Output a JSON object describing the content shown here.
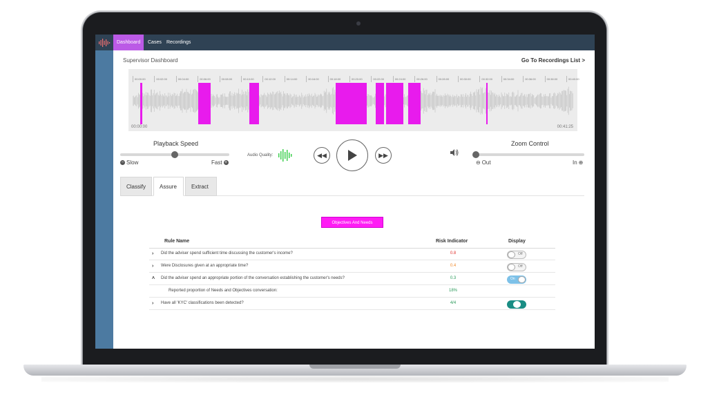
{
  "nav": {
    "tabs": [
      {
        "label": "Dashboard",
        "active": true
      },
      {
        "label": "Cases",
        "active": false
      },
      {
        "label": "Recordings",
        "active": false
      }
    ]
  },
  "header": {
    "title": "Supervisor Dashboard",
    "link": "Go To Recordings List >"
  },
  "waveform": {
    "tick_labels": [
      "00:00:00",
      "00:02:00",
      "00:04:00",
      "00:06:00",
      "00:08:00",
      "00:10:00",
      "00:12:00",
      "00:14:00",
      "00:16:00",
      "00:18:00",
      "00:20:00",
      "00:22:00",
      "00:24:00",
      "00:26:00",
      "00:28:00",
      "00:30:00",
      "00:32:00",
      "00:34:00",
      "00:36:00",
      "00:38:00",
      "00:40:00"
    ],
    "start_time": "00:00:00",
    "end_time": "00:41:25",
    "highlight_color": "#e81bed"
  },
  "controls": {
    "playback_label": "Playback Speed",
    "slow_label": "Slow",
    "fast_label": "Fast",
    "playback_level": 0.5,
    "audio_quality_label": "Audio Quality:",
    "zoom_label": "Zoom Control",
    "out_label": "Out",
    "in_label": "In",
    "zoom_level": 0.0
  },
  "tabs": [
    {
      "label": "Classify",
      "active": false
    },
    {
      "label": "Assure",
      "active": true
    },
    {
      "label": "Extract",
      "active": false
    }
  ],
  "objectives_button": "Objectives And Needs",
  "table": {
    "headers": {
      "rule": "Rule Name",
      "risk": "Risk Indicator",
      "display": "Display"
    },
    "rows": [
      {
        "chevron": "›",
        "rule": "Did the adviser spend sufficient time discussing the customer's income?",
        "risk": "0.8",
        "risk_color": "#e0302b",
        "toggle": "Off"
      },
      {
        "chevron": "›",
        "rule": "Were Disclosures given at an appropriate time?",
        "risk": "0.4",
        "risk_color": "#f08a2a",
        "toggle": "Off"
      },
      {
        "chevron": "˄",
        "rule": "Did the adviser spend an appropriate portion of the conversation establishing the customer's needs?",
        "risk": "0.3",
        "risk_color": "#2a9a5a",
        "toggle": "On"
      },
      {
        "chevron": "",
        "rule": "Reported proportion of Needs and Objectives conversation:",
        "risk": "18%",
        "risk_color": "#2a9a5a",
        "toggle": ""
      },
      {
        "chevron": "›",
        "rule": "Have all 'KYC' classifications been detected?",
        "risk": "4/4",
        "risk_color": "#2a9a5a",
        "toggle": "dark"
      }
    ]
  }
}
